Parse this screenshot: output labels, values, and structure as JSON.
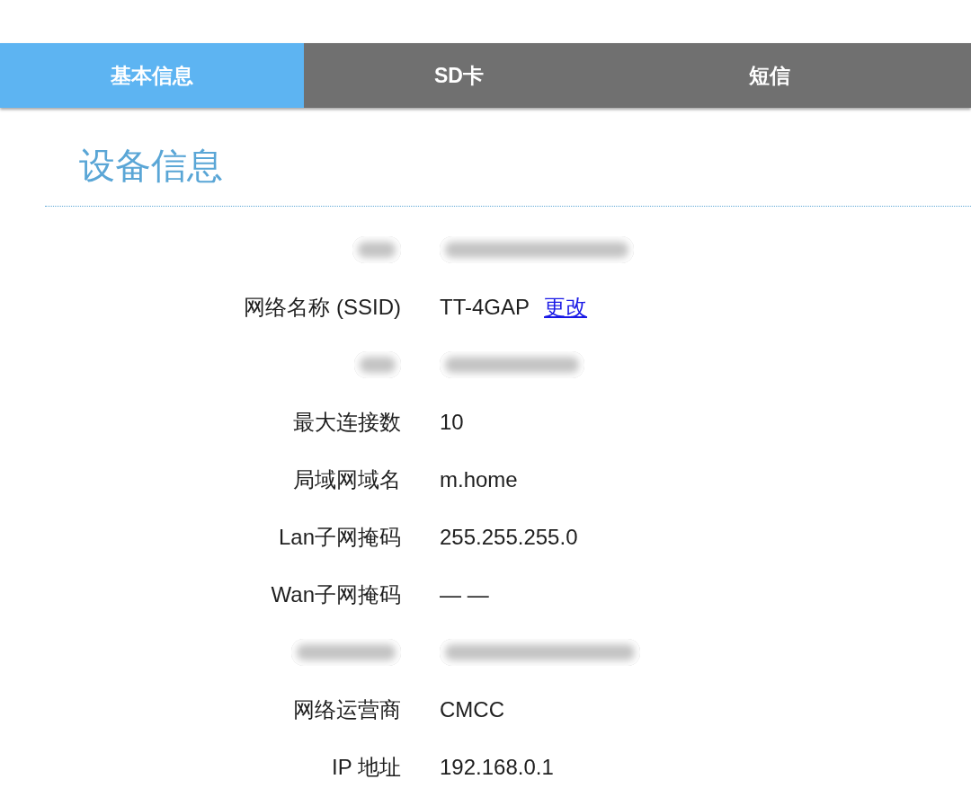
{
  "tabs": [
    {
      "label": "基本信息",
      "selected": true
    },
    {
      "label": "SD卡",
      "selected": false
    },
    {
      "label": "短信",
      "selected": false
    }
  ],
  "section": {
    "title": "设备信息"
  },
  "rows": [
    {
      "kind": "redacted"
    },
    {
      "kind": "text",
      "label": "网络名称 (SSID)",
      "value": "TT-4GAP",
      "link": "更改"
    },
    {
      "kind": "redacted"
    },
    {
      "kind": "text",
      "label": "最大连接数",
      "value": "10"
    },
    {
      "kind": "text",
      "label": "局域网域名",
      "value": "m.home"
    },
    {
      "kind": "text",
      "label": "Lan子网掩码",
      "value": "255.255.255.0"
    },
    {
      "kind": "text",
      "label": "Wan子网掩码",
      "value": "— —"
    },
    {
      "kind": "redacted"
    },
    {
      "kind": "text",
      "label": "网络运营商",
      "value": "CMCC"
    },
    {
      "kind": "text",
      "label": "IP 地址",
      "value": "192.168.0.1"
    }
  ]
}
